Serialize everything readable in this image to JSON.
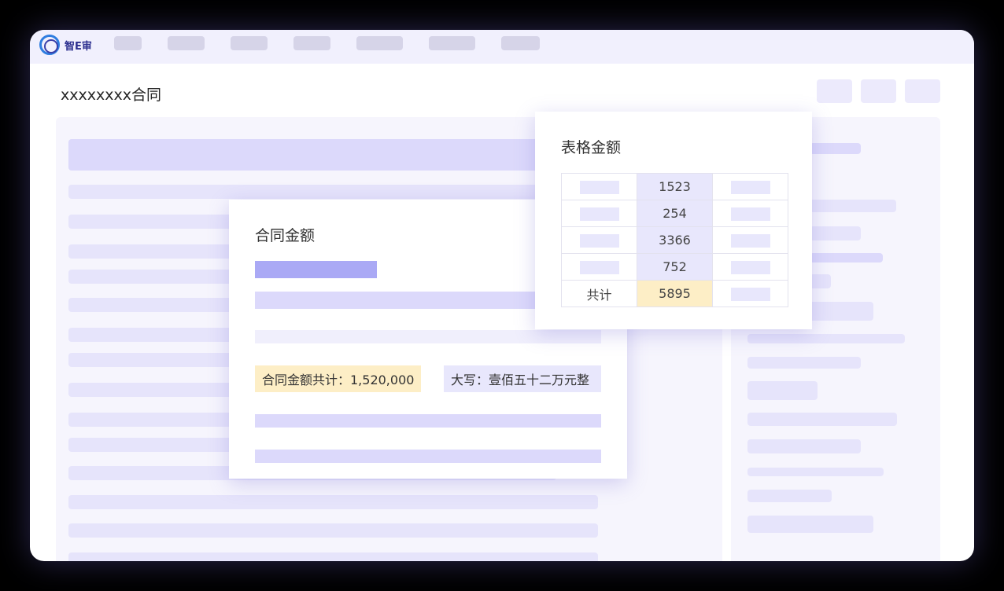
{
  "app": {
    "logo_text": "智E审"
  },
  "document": {
    "title": "xxxxxxxx合同"
  },
  "contract_card": {
    "title": "合同金额",
    "total_label": "合同金额共计：1,520,000",
    "uppercase_label": "大写：壹佰五十二万元整"
  },
  "table_card": {
    "title": "表格金额",
    "rows": [
      {
        "label": "",
        "value": "1523"
      },
      {
        "label": "",
        "value": "254"
      },
      {
        "label": "",
        "value": "3366"
      },
      {
        "label": "",
        "value": "752"
      }
    ],
    "total_label": "共计",
    "total_value": "5895"
  },
  "colors": {
    "highlight_yellow": "#fdeec6",
    "highlight_lavender": "#e8e7fc",
    "accent_bar": "#aaa9f5",
    "logo_blue": "#2f7de0"
  }
}
